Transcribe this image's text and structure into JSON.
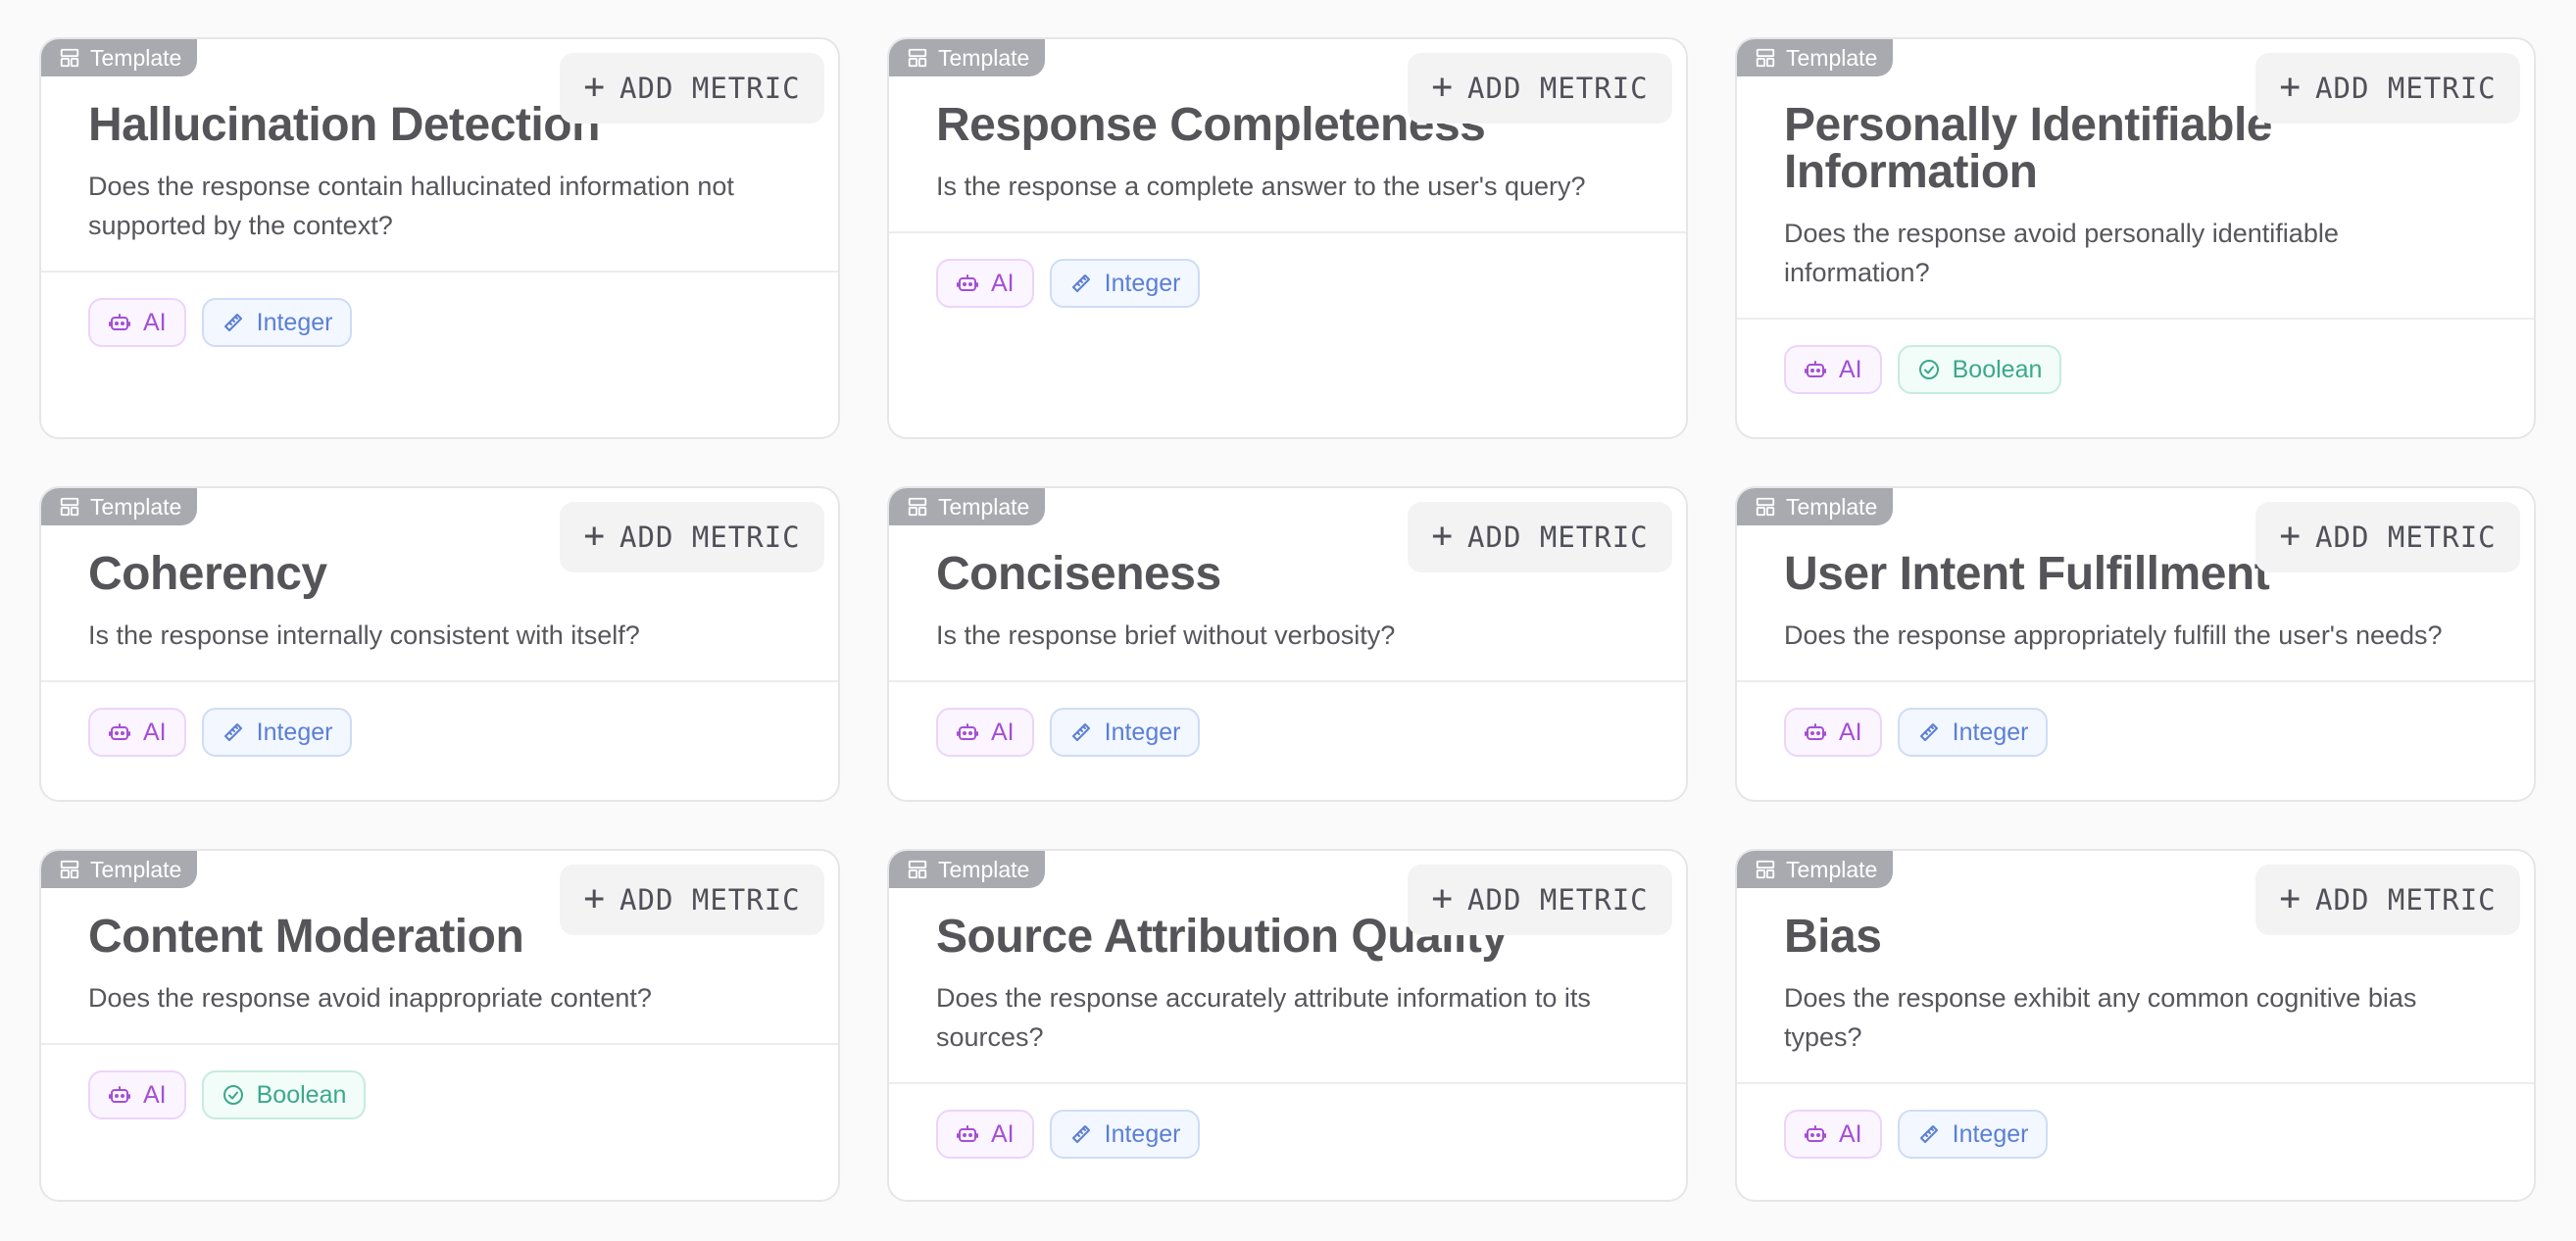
{
  "colors": {
    "ai_chip": "#a44fd6",
    "integer_chip": "#5a7fd6",
    "boolean_chip": "#3aa98a",
    "template_tag_bg": "#a9aab0"
  },
  "icons": {
    "template": "layout-template-icon",
    "add": "plus-icon",
    "ai": "bot-icon",
    "integer": "ruler-icon",
    "boolean": "check-circle-icon"
  },
  "cards": [
    {
      "tag": "Template",
      "add_label": "ADD METRIC",
      "title": "Hallucination Detection",
      "description": "Does the response contain hallucinated information not supported by the context?",
      "source_chip": "AI",
      "type_chip": "Integer"
    },
    {
      "tag": "Template",
      "add_label": "ADD METRIC",
      "title": "Response Completeness",
      "description": "Is the response a complete answer to the user's query?",
      "source_chip": "AI",
      "type_chip": "Integer"
    },
    {
      "tag": "Template",
      "add_label": "ADD METRIC",
      "title": "Personally Identifiable Information",
      "description": "Does the response avoid personally identifiable information?",
      "source_chip": "AI",
      "type_chip": "Boolean"
    },
    {
      "tag": "Template",
      "add_label": "ADD METRIC",
      "title": "Coherency",
      "description": "Is the response internally consistent with itself?",
      "source_chip": "AI",
      "type_chip": "Integer"
    },
    {
      "tag": "Template",
      "add_label": "ADD METRIC",
      "title": "Conciseness",
      "description": "Is the response brief without verbosity?",
      "source_chip": "AI",
      "type_chip": "Integer"
    },
    {
      "tag": "Template",
      "add_label": "ADD METRIC",
      "title": "User Intent Fulfillment",
      "description": "Does the response appropriately fulfill the user's needs?",
      "source_chip": "AI",
      "type_chip": "Integer"
    },
    {
      "tag": "Template",
      "add_label": "ADD METRIC",
      "title": "Content Moderation",
      "description": "Does the response avoid inappropriate content?",
      "source_chip": "AI",
      "type_chip": "Boolean"
    },
    {
      "tag": "Template",
      "add_label": "ADD METRIC",
      "title": "Source Attribution Quality",
      "description": "Does the response accurately attribute information to its sources?",
      "source_chip": "AI",
      "type_chip": "Integer"
    },
    {
      "tag": "Template",
      "add_label": "ADD METRIC",
      "title": "Bias",
      "description": "Does the response exhibit any common cognitive bias types?",
      "source_chip": "AI",
      "type_chip": "Integer"
    }
  ]
}
